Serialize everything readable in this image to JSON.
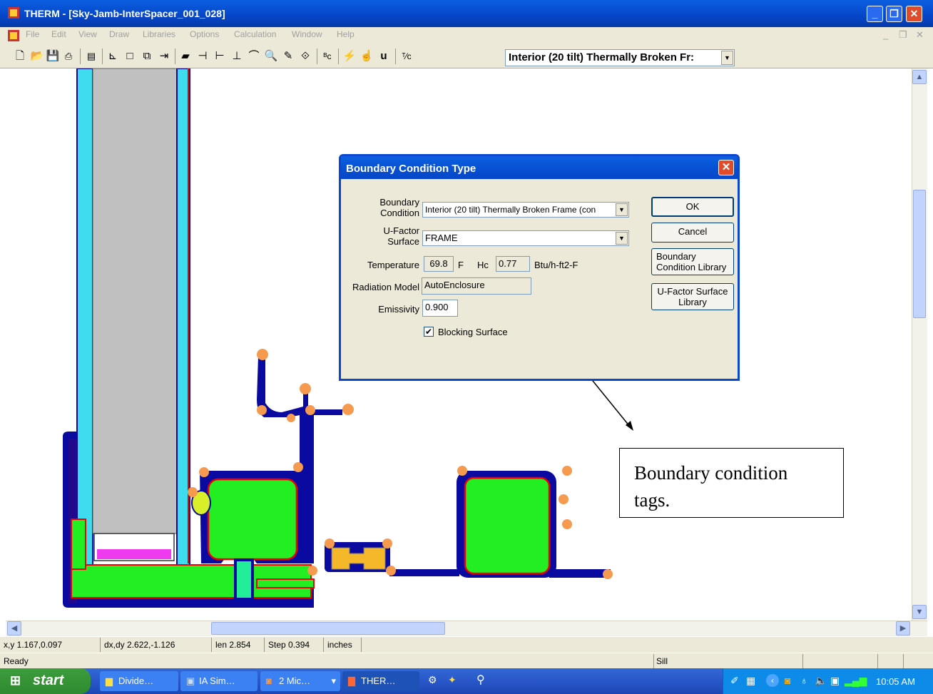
{
  "window": {
    "title": "THERM - [Sky-Jamb-InterSpacer_001_028]"
  },
  "menu": [
    "File",
    "Edit",
    "View",
    "Draw",
    "Libraries",
    "Options",
    "Calculation",
    "Window",
    "Help"
  ],
  "toolbar": {
    "boundary_select_value": "Interior (20 tilt) Thermally Broken Fr:"
  },
  "dialog": {
    "title": "Boundary Condition Type",
    "bc_label_1": "Boundary",
    "bc_label_2": "Condition",
    "bc_value": "Interior (20 tilt) Thermally Broken Frame (con",
    "uf_label_1": "U-Factor",
    "uf_label_2": "Surface",
    "uf_value": "FRAME",
    "temp_label": "Temperature",
    "temp_value": "69.8",
    "temp_unit": "F",
    "hc_label": "Hc",
    "hc_value": "0.77",
    "hc_unit": "Btu/h-ft2-F",
    "rad_label": "Radiation Model",
    "rad_value": "AutoEnclosure",
    "emis_label": "Emissivity",
    "emis_value": "0.900",
    "blocking_label": "Blocking Surface",
    "blocking_checked": true,
    "ok_label": "OK",
    "cancel_label": "Cancel",
    "bclib_label_1": "Boundary",
    "bclib_label_2": "Condition Library",
    "uflib_label_1": "U-Factor Surface",
    "uflib_label_2": "Library"
  },
  "callout": {
    "line1": "Boundary condition",
    "line2": "tags."
  },
  "status": {
    "xy": "x,y 1.167,0.097",
    "dxdy": "dx,dy 2.622,-1.126",
    "len": "len 2.854",
    "step": "Step 0.394",
    "units": "inches",
    "ready": "Ready",
    "sill": "Sill"
  },
  "taskbar": {
    "start": "start",
    "tasks": [
      "Divide…",
      "IA Sim…",
      "2 Mic…",
      "THER…"
    ],
    "clock": "10:05 AM"
  },
  "colors": {
    "titlebar": "#0745c8",
    "glazing": "#3fdcf0",
    "frame_fill": "#22ee22",
    "outline": "#0a0aa0",
    "tags": "#f59a4e"
  }
}
